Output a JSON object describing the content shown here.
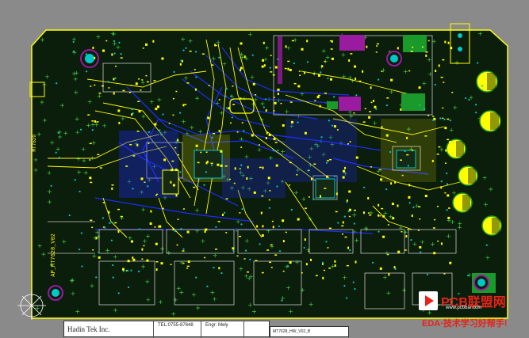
{
  "app": {
    "view": "PCB layout editor - board view"
  },
  "colors": {
    "background": "#8a8a8a",
    "board": "#0b1d0b",
    "outline": "#ffff00",
    "top_copper": "#ffff00",
    "bottom_copper": "#1e2cff",
    "silkscreen": "#c8c8c8",
    "pad_green": "#1a9a2a",
    "keepout_magenta": "#9a1aa0",
    "via_cyan": "#00c8c8",
    "origin_white": "#ffffff"
  },
  "labels": {
    "board_vertical": "AP_MT7628_V02",
    "board_vertical_small": "MT7620",
    "company": "Hadin Tek Inc.",
    "tel": "TEL:0755-87648",
    "engineer": "Engr: Mely",
    "revision": "MT7628_HW_V02_B"
  },
  "watermark": {
    "brand": "PCB联盟网",
    "url": "www.pcbbar.com",
    "slogan": "EDA·技术学习好帮手!"
  },
  "icons": {
    "watermark_logo": "play-logo-icon",
    "origin": "origin-crosshair-icon"
  }
}
